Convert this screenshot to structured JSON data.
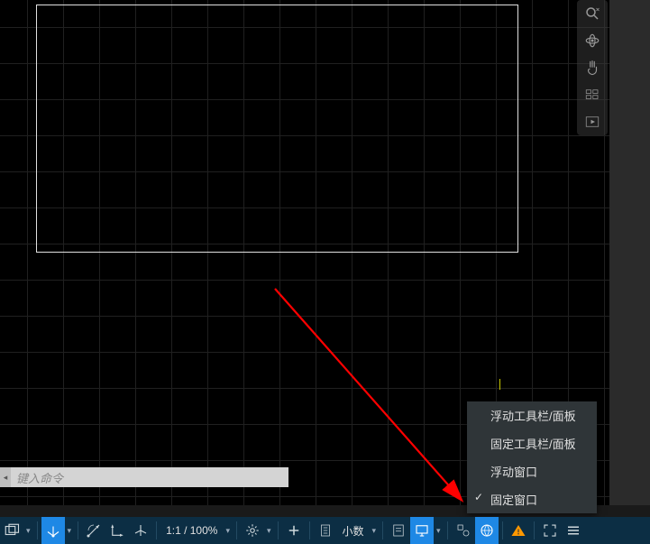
{
  "canvas": {
    "selection_visible": true
  },
  "nav_palette": {
    "items": [
      {
        "name": "zoom-extents-icon"
      },
      {
        "name": "orbit-icon"
      },
      {
        "name": "pan-icon"
      },
      {
        "name": "views-icon"
      },
      {
        "name": "play-icon"
      }
    ]
  },
  "command": {
    "placeholder": "键入命令",
    "handle": "◂"
  },
  "context_menu": {
    "items": [
      {
        "label": "浮动工具栏/面板",
        "checked": false
      },
      {
        "label": "固定工具栏/面板",
        "checked": false
      },
      {
        "label": "浮动窗口",
        "checked": false
      },
      {
        "label": "固定窗口",
        "checked": true
      }
    ]
  },
  "statusbar": {
    "model_label": "",
    "grid_icon": "grid-icon",
    "ucs_icon": "ucs-icon",
    "dropdown_caret": "▾",
    "polar_icon": "polar-icon",
    "ortho_icon": "ortho-icon",
    "iso_icon": "iso-icon",
    "zoom_label": "1:1 / 100%",
    "gear_icon": "settings-icon",
    "plus_icon": "add-icon",
    "anno_icon": "annotation-icon",
    "units_label": "小数",
    "props_icon": "properties-icon",
    "monitor_icon": "monitor-icon",
    "group_icon": "group-icon",
    "globe_icon": "globe-icon",
    "warn_icon": "warning-icon",
    "fullscreen_icon": "fullscreen-icon",
    "menu_icon": "menu-icon"
  }
}
